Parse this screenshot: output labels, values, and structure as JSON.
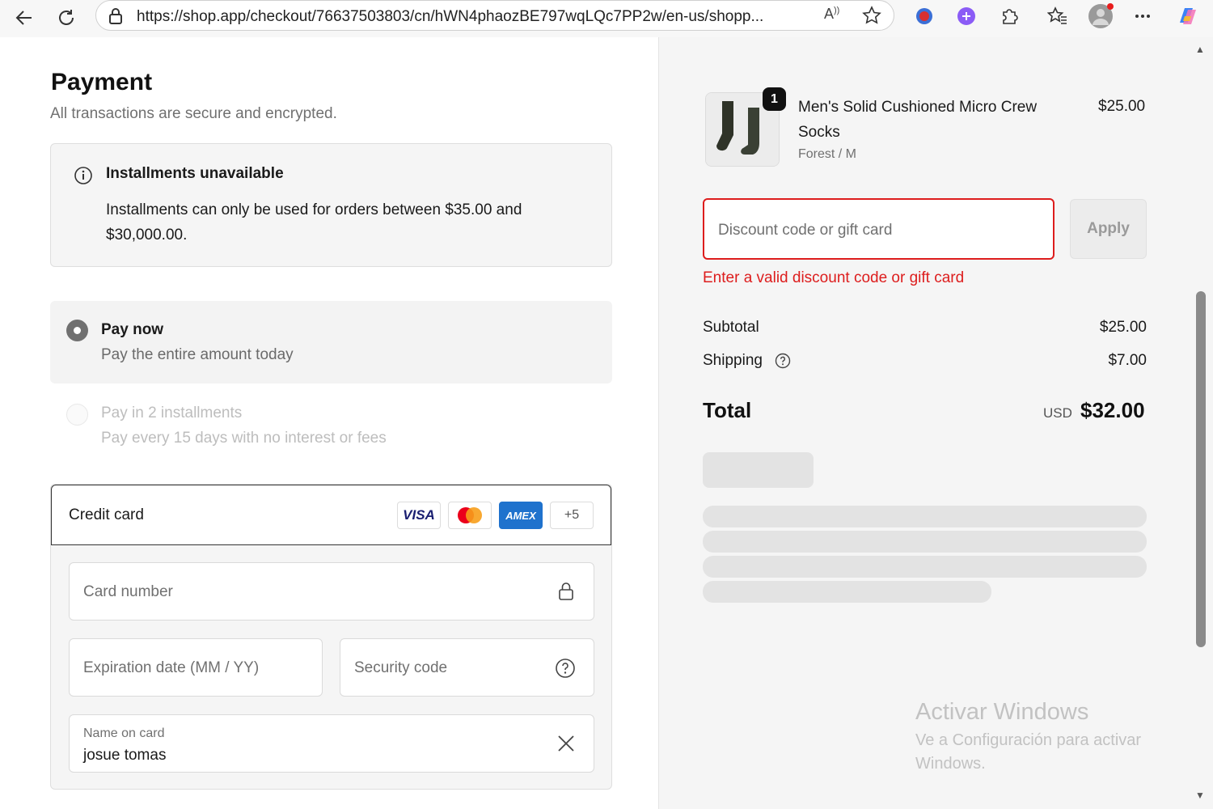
{
  "browser": {
    "url": "https://shop.app/checkout/76637503803/cn/hWN4phaozBE797wqLQc7PP2w/en-us/shopp...",
    "read_aloud": "A⁾"
  },
  "payment": {
    "title": "Payment",
    "subtitle": "All transactions are secure and encrypted.",
    "notice_title": "Installments unavailable",
    "notice_body": "Installments can only be used for orders between $35.00 and $30,000.00.",
    "options": [
      {
        "title": "Pay now",
        "desc": "Pay the entire amount today",
        "selected": true
      },
      {
        "title": "Pay in 2 installments",
        "desc": "Pay every 15 days with no interest or fees",
        "selected": false
      }
    ],
    "credit_card": {
      "label": "Credit card",
      "brands": [
        "VISA",
        "",
        "AMEX",
        "+5"
      ],
      "card_number_placeholder": "Card number",
      "expiration_placeholder": "Expiration date (MM / YY)",
      "security_placeholder": "Security code",
      "name_label": "Name on card",
      "name_value": "josue tomas"
    }
  },
  "summary": {
    "product": {
      "name": "Men's Solid Cushioned Micro Crew Socks",
      "variant": "Forest / M",
      "price": "$25.00",
      "quantity": "1"
    },
    "discount_placeholder": "Discount code or gift card",
    "apply_label": "Apply",
    "discount_error": "Enter a valid discount code or gift card",
    "subtotal_label": "Subtotal",
    "subtotal_value": "$25.00",
    "shipping_label": "Shipping",
    "shipping_value": "$7.00",
    "total_label": "Total",
    "total_currency": "USD",
    "total_value": "$32.00"
  },
  "watermark": {
    "line1": "Activar Windows",
    "line2": "Ve a Configuración para activar Windows."
  },
  "colors": {
    "error": "#dd1d1d",
    "amex": "#1f72cd",
    "visa": "#1a1f71"
  }
}
